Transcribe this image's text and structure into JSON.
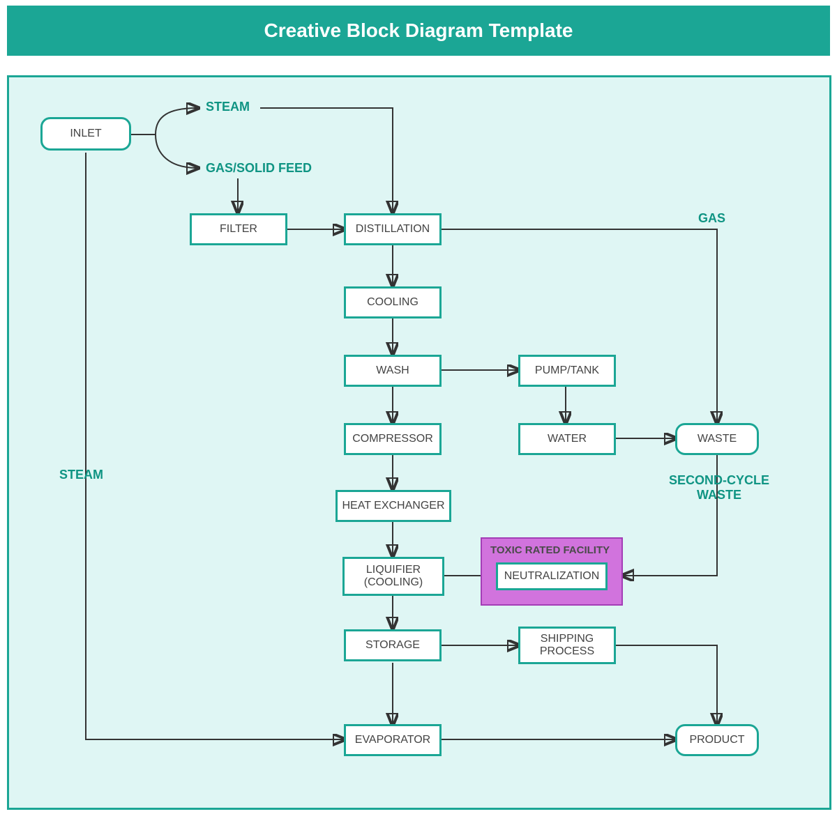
{
  "title": "Creative Block Diagram Template",
  "boxes": {
    "inlet": "INLET",
    "filter": "FILTER",
    "distillation": "DISTILLATION",
    "cooling": "COOLING",
    "wash": "WASH",
    "pumptank": "PUMP/TANK",
    "compressor": "COMPRESSOR",
    "water": "WATER",
    "waste": "WASTE",
    "heatex": "HEAT EXCHANGER",
    "liquifier": "LIQUIFIER (COOLING)",
    "neutralization": "NEUTRALIZATION",
    "storage": "STORAGE",
    "shipping": "SHIPPING PROCESS",
    "evaporator": "EVAPORATOR",
    "product": "PRODUCT"
  },
  "labels": {
    "steam_top": "STEAM",
    "gas_solid_feed": "GAS/SOLID FEED",
    "gas": "GAS",
    "steam_left": "STEAM",
    "second_cycle": "SECOND-CYCLE WASTE",
    "toxic": "TOXIC RATED FACILITY"
  },
  "colors": {
    "accent": "#1ba695",
    "bg": "#dff6f4",
    "toxic": "#d173dd"
  }
}
